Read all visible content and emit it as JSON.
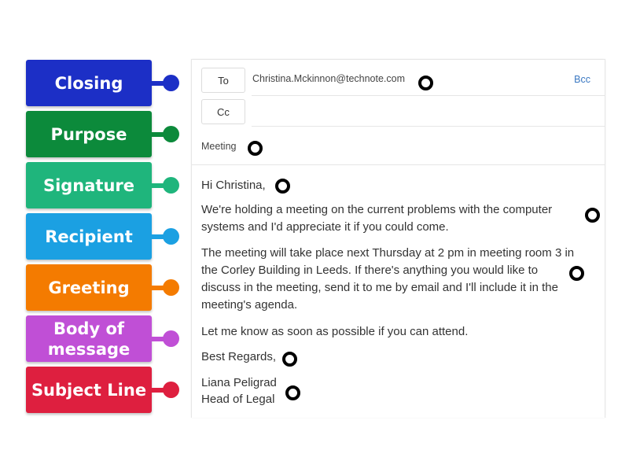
{
  "labels": [
    {
      "text": "Closing",
      "color": "#1c2fc6"
    },
    {
      "text": "Purpose",
      "color": "#0c8a3b"
    },
    {
      "text": "Signature",
      "color": "#1fb57c"
    },
    {
      "text": "Recipient",
      "color": "#1ba0e2"
    },
    {
      "text": "Greeting",
      "color": "#f47b00"
    },
    {
      "text": "Body of message",
      "color": "#c04fd6"
    },
    {
      "text": "Subject Line",
      "color": "#de1f3f"
    }
  ],
  "email": {
    "to_button": "To",
    "cc_button": "Cc",
    "bcc_link": "Bcc",
    "to_value": "Christina.Mckinnon@technote.com",
    "cc_value": "",
    "subject": "Meeting",
    "greeting": "Hi Christina,",
    "para1_line1": "We're holding a meeting on the current problems with the computer",
    "para1_line2": "systems and I'd appreciate it if you could come.",
    "para2_line1": "The meeting will take place next Thursday at 2 pm in meeting room 3 in",
    "para2_line2": "the Corley Building in Leeds.  If there's anything you would like to",
    "para2_line3": "discuss in the meeting, send it to me by email and I'll include it in the",
    "para2_line4": "meeting's agenda.",
    "para3": "Let me know as soon as possible if you can attend.",
    "closing": "Best Regards,",
    "signature_name": "Liana Peligrad",
    "signature_title": "Head of Legal"
  },
  "drop_targets": [
    "recipient",
    "subject",
    "greeting",
    "purpose",
    "body",
    "closing",
    "signature"
  ]
}
